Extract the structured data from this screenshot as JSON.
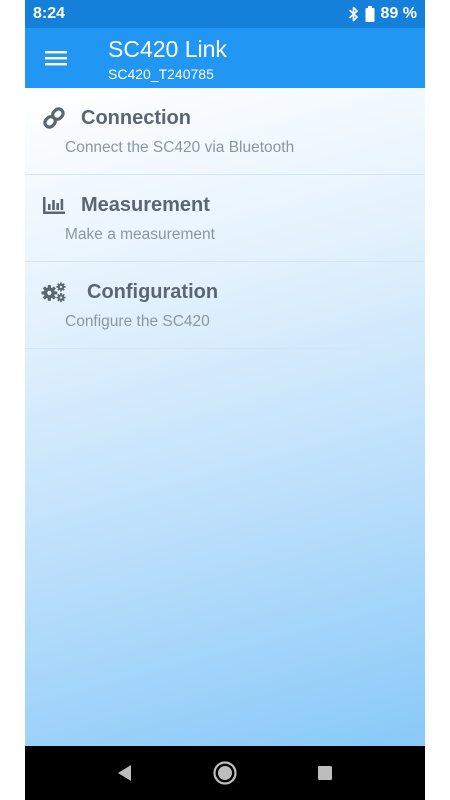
{
  "status_bar": {
    "time": "8:24",
    "battery": "89 %",
    "icons": [
      "bluetooth-icon",
      "battery-icon"
    ]
  },
  "app_bar": {
    "title": "SC420 Link",
    "subtitle": "SC420_T240785",
    "menu_icon": "hamburger-menu-icon"
  },
  "menu": {
    "items": [
      {
        "icon": "link-icon",
        "title": "Connection",
        "subtitle": "Connect the SC420 via Bluetooth"
      },
      {
        "icon": "bar-chart-icon",
        "title": "Measurement",
        "subtitle": "Make a measurement"
      },
      {
        "icon": "gears-icon",
        "title": "Configuration",
        "subtitle": "Configure the SC420"
      }
    ]
  },
  "nav_bar": {
    "buttons": [
      "back-icon",
      "home-icon",
      "recents-icon"
    ]
  },
  "colors": {
    "status_bar": "#1580d9",
    "app_bar": "#2196f3",
    "title_text": "#5b6670",
    "subtitle_text": "#8d969e",
    "nav_bar": "#000000"
  }
}
